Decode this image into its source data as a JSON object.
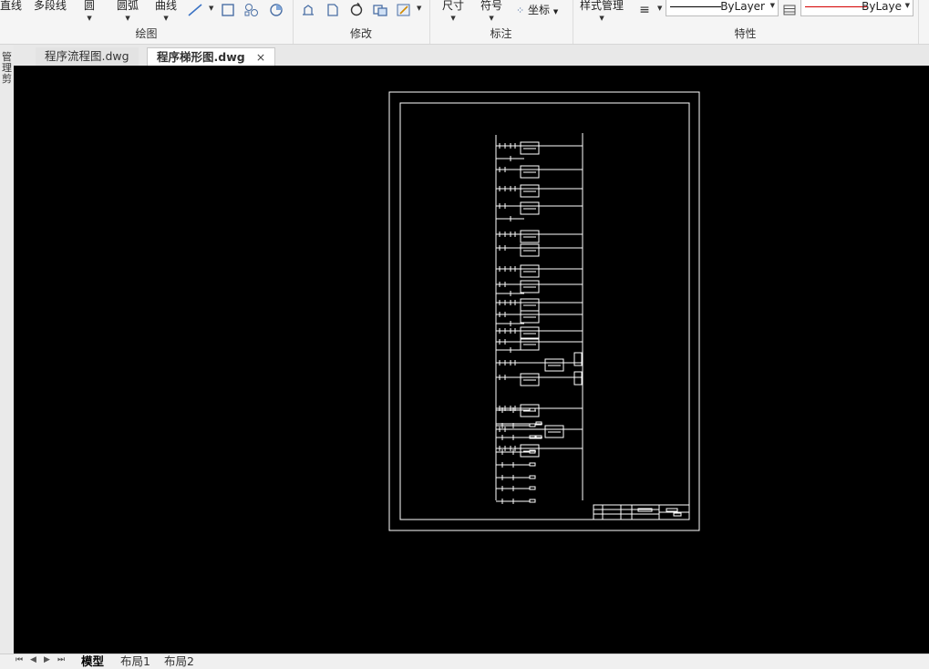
{
  "ribbon": {
    "draw_group": {
      "title": "绘图",
      "tools": [
        "直线",
        "多段线",
        "圆",
        "圆弧",
        "曲线"
      ]
    },
    "modify_group": {
      "title": "修改"
    },
    "annotate_group": {
      "title": "标注",
      "tools": [
        "尺寸",
        "符号",
        "坐标"
      ]
    },
    "properties_group": {
      "title": "特性",
      "style_manager": "样式管理",
      "linetype": "ByLayer",
      "color": "ByLaye",
      "linetype_color": "#000000",
      "color_line": "#d40000"
    }
  },
  "side_panel": {
    "label": "管理 剪"
  },
  "tabs": [
    {
      "label": "程序流程图.dwg",
      "active": false
    },
    {
      "label": "程序梯形图.dwg",
      "active": true,
      "close": "×"
    }
  ],
  "layout_tabs": [
    "模型",
    "布局1",
    "布局2"
  ],
  "icons": {
    "line_icon": "line-tool-icon",
    "rectangle_icon": "rectangle-icon",
    "hatch_icon": "hatch-icon",
    "region_icon": "region-icon",
    "move_icon": "move-icon",
    "stretch_icon": "stretch-icon",
    "rotate_icon": "rotate-icon",
    "copy_icon": "copy-icon",
    "edit_icon": "edit-icon",
    "lineweight_icon": "lineweight-icon",
    "grid_icon": "table-icon"
  },
  "canvas": {
    "background": "#000000",
    "drawing_color": "#ffffff"
  }
}
